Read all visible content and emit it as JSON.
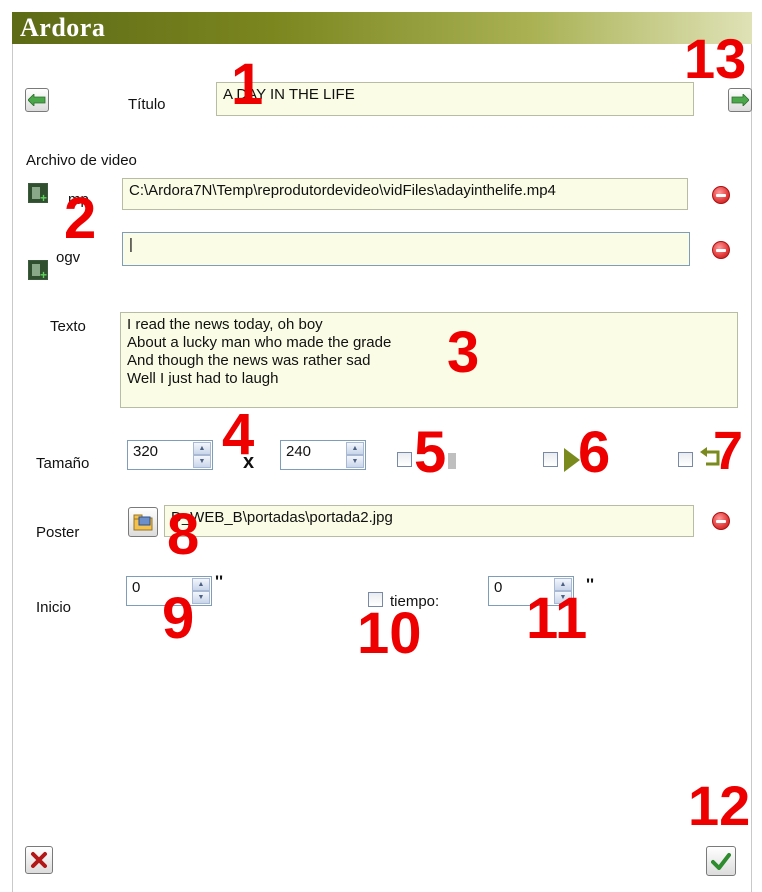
{
  "app": {
    "title": "Ardora"
  },
  "header": {
    "titulo_label": "Título",
    "titulo_value": "A DAY IN THE LIFE"
  },
  "video": {
    "section_label": "Archivo de video",
    "mp4_label": "mp",
    "mp4_value": "C:\\Ardora7N\\Temp\\reprodutordevideo\\vidFiles\\adayinthelife.mp4",
    "ogv_label": "ogv",
    "ogv_value": "|"
  },
  "texto": {
    "label": "Texto",
    "lines": [
      "I read the news today, oh boy",
      "About a lucky man who made the grade",
      "And though the news was rather sad",
      "Well I just had to laugh"
    ]
  },
  "size": {
    "label": "Tamaño",
    "width": "320",
    "height": "240",
    "separator": "x"
  },
  "poster": {
    "label": "Poster",
    "value": "D_WEB_B\\portadas\\portada2.jpg"
  },
  "inicio": {
    "label": "Inicio",
    "value": "0",
    "unit": "''"
  },
  "tiempo": {
    "label": "tiempo:",
    "value": "0",
    "unit": "''"
  },
  "annotations": [
    "1",
    "2",
    "3",
    "4",
    "5",
    "6",
    "7",
    "8",
    "9",
    "10",
    "11",
    "12",
    "13"
  ],
  "colors": {
    "title_bar": "#6b7a1c",
    "field_bg": "#fafce6",
    "annotation": "#ee0000"
  }
}
